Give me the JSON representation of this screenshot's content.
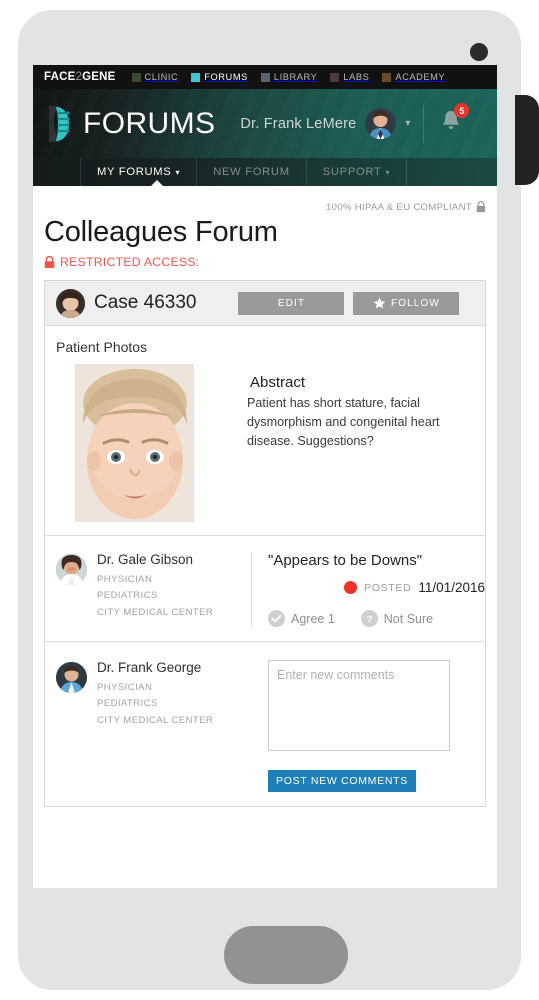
{
  "topbar": {
    "brand": "FACE2GENE",
    "brand_prefix": "FACE",
    "brand_two": "2",
    "brand_suffix": "GENE",
    "apps": [
      {
        "label": "CLINIC",
        "color": "#3a4a2e",
        "active": false
      },
      {
        "label": "FORUMS",
        "color": "#3fc6cf",
        "active": true
      },
      {
        "label": "LIBRARY",
        "color": "#5a6272",
        "active": false
      },
      {
        "label": "LABS",
        "color": "#4d3740",
        "active": false
      },
      {
        "label": "ACADEMY",
        "color": "#6b4a28",
        "active": false
      }
    ]
  },
  "header": {
    "logo_text": "FORUMS",
    "logo_icon": "head-dna-icon",
    "user_name": "Dr. Frank LeMere",
    "user_caret_icon": "chevron-down-icon",
    "bell_icon": "bell-icon",
    "notification_count": "5",
    "accent_color": "#1b635a",
    "badge_color": "#e8342a"
  },
  "subnav": {
    "items": [
      {
        "label": "MY FORUMS",
        "caret": "⌄",
        "active": true
      },
      {
        "label": "NEW FORUM",
        "caret": "",
        "active": false
      },
      {
        "label": "SUPPORT",
        "caret": "⌄",
        "active": false
      }
    ]
  },
  "page": {
    "hipaa_notice": "100% HIPAA & EU COMPLIANT",
    "hipaa_icon": "lock-icon",
    "title": "Colleagues Forum",
    "restricted_label": "RESTRICTED ACCESS:",
    "restricted_icon": "lock-closed-icon",
    "restricted_color": "#f4544b"
  },
  "case": {
    "avatar_icon": "case-avatar",
    "title": "Case 46330",
    "edit_label": "EDIT",
    "follow_label": "FOLLOW",
    "follow_icon": "star-icon",
    "photos_heading": "Patient Photos",
    "patient_photo_icon": "patient-photo",
    "abstract_heading": "Abstract",
    "abstract_text": "Patient has short stature, facial dysmorphism and congenital heart disease. Suggestions?"
  },
  "comments": [
    {
      "avatar_icon": "gale-gibson-avatar",
      "name": "Dr. Gale Gibson",
      "role": "PHYSICIAN",
      "specialty": "PEDIATRICS",
      "institution": "CITY MEDICAL CENTER",
      "quote": "\"Appears to be Downs\"",
      "status_dot_color": "#ee3326",
      "posted_label": "POSTED",
      "posted_date": "11/01/2016",
      "agree_label": "Agree 1",
      "agree_icon": "check-circle-icon",
      "not_sure_label": "Not Sure",
      "not_sure_icon": "question-circle-icon"
    }
  ],
  "compose": {
    "avatar_icon": "frank-george-avatar",
    "name": "Dr. Frank George",
    "role": "PHYSICIAN",
    "specialty": "PEDIATRICS",
    "institution": "CITY MEDICAL CENTER",
    "input_value": "",
    "input_placeholder": "Enter new comments",
    "post_label": "POST NEW COMMENTS",
    "post_color": "#1f7fb8"
  },
  "device": {
    "camera_icon": "camera-dot",
    "home_button_icon": "home-button",
    "side_button_icon": "power-button"
  }
}
